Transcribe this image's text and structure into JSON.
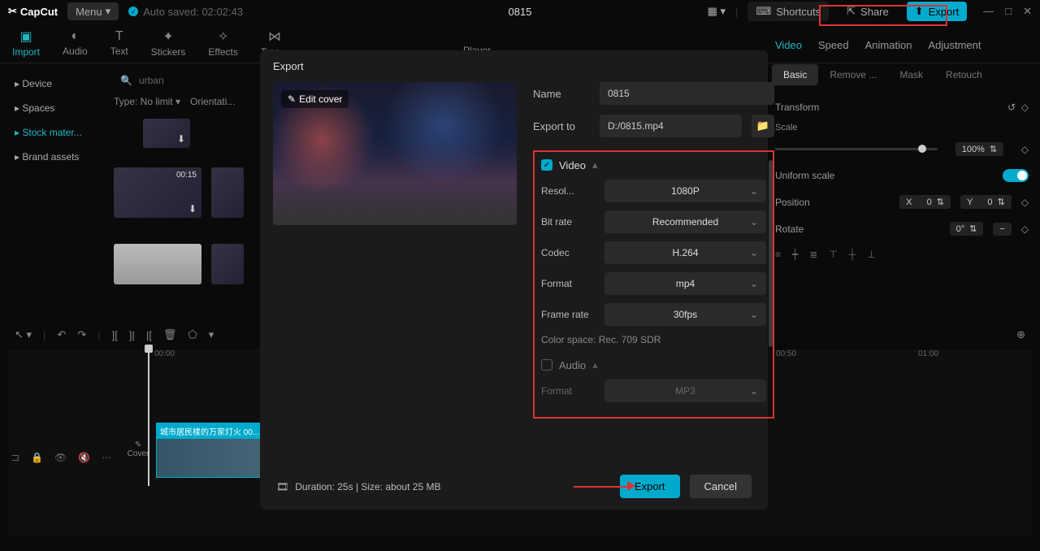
{
  "app": {
    "name": "CapCut",
    "menu": "Menu",
    "autosave": "Auto saved: 02:02:43",
    "project": "0815"
  },
  "topButtons": {
    "shortcuts": "Shortcuts",
    "share": "Share",
    "export": "Export"
  },
  "tabs": [
    "Import",
    "Audio",
    "Text",
    "Stickers",
    "Effects",
    "Tran..."
  ],
  "sidebar": [
    "Device",
    "Spaces",
    "Stock mater...",
    "Brand assets"
  ],
  "media": {
    "search": "urban",
    "filter1": "Type: No limit",
    "filter2": "Orientati...",
    "dur": "00:15"
  },
  "player": "Player",
  "rightPanel": {
    "tabs": [
      "Video",
      "Speed",
      "Animation",
      "Adjustment"
    ],
    "subtabs": [
      "Basic",
      "Remove ...",
      "Mask",
      "Retouch"
    ],
    "transform": "Transform",
    "scale": "Scale",
    "scaleVal": "100%",
    "uniform": "Uniform scale",
    "position": "Position",
    "x": "X",
    "xv": "0",
    "y": "Y",
    "yv": "0",
    "rotate": "Rotate",
    "rv": "0°"
  },
  "timeline": {
    "marks": [
      "00:00",
      "00:50",
      "01:00"
    ],
    "clip": "城市居民楼的万家灯火   00...",
    "cover": "Cover"
  },
  "dialog": {
    "title": "Export",
    "editCover": "Edit cover",
    "name": {
      "label": "Name",
      "value": "0815"
    },
    "exportTo": {
      "label": "Export to",
      "value": "D:/0815.mp4"
    },
    "video": {
      "title": "Video",
      "resolution": {
        "label": "Resol...",
        "value": "1080P"
      },
      "bitrate": {
        "label": "Bit rate",
        "value": "Recommended"
      },
      "codec": {
        "label": "Codec",
        "value": "H.264"
      },
      "format": {
        "label": "Format",
        "value": "mp4"
      },
      "framerate": {
        "label": "Frame rate",
        "value": "30fps"
      },
      "colorspace": "Color space: Rec. 709 SDR"
    },
    "audio": {
      "title": "Audio",
      "format": {
        "label": "Format",
        "value": "MP3"
      }
    },
    "footer": {
      "info": "Duration: 25s | Size: about 25 MB",
      "export": "Export",
      "cancel": "Cancel"
    }
  }
}
